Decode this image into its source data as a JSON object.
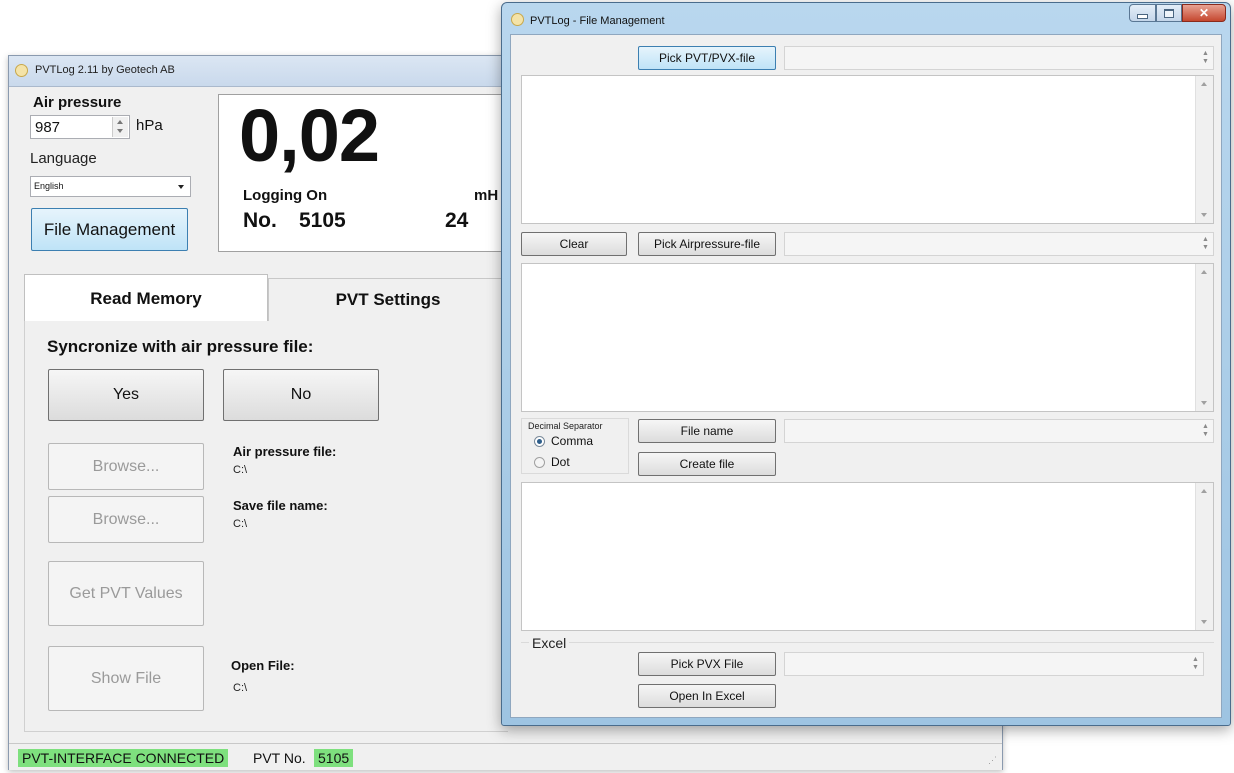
{
  "main_window": {
    "title": "PVTLog 2.11 by Geotech AB",
    "air_pressure_label": "Air pressure",
    "air_pressure_value": "987",
    "air_pressure_unit": "hPa",
    "language_label": "Language",
    "language_value": "English",
    "file_management_button": "File Management",
    "big_value": "0,02",
    "logging_status": "Logging On",
    "unit_partial": "mH",
    "number_label": "No.",
    "number_value": "5105",
    "second_value": "24",
    "tabs": [
      {
        "label": "Read Memory",
        "active": true
      },
      {
        "label": "PVT Settings",
        "active": false
      }
    ],
    "sync_heading": "Syncronize with air pressure file:",
    "yes_button": "Yes",
    "no_button": "No",
    "browse_button_1": "Browse...",
    "browse_button_2": "Browse...",
    "get_pvt_button": "Get PVT Values",
    "show_file_button": "Show File",
    "air_pressure_file_label": "Air pressure file:",
    "air_pressure_file_value": "C:\\",
    "save_file_label": "Save file name:",
    "save_file_value": "C:\\",
    "open_file_label": "Open File:",
    "open_file_value": "C:\\",
    "status_connected": "PVT-INTERFACE CONNECTED",
    "status_pvt_label": "PVT No.",
    "status_pvt_value": "5105"
  },
  "file_window": {
    "title": "PVTLog - File Management",
    "pick_pvt_button": "Pick PVT/PVX-file",
    "clear_button": "Clear",
    "pick_airpressure_button": "Pick Airpressure-file",
    "decimal_separator_label": "Decimal Separator",
    "radio_comma": "Comma",
    "radio_dot": "Dot",
    "decimal_selected": "Comma",
    "file_name_button": "File name",
    "create_file_button": "Create file",
    "excel_label": "Excel",
    "pick_pvx_button": "Pick PVX File",
    "open_excel_button": "Open In Excel"
  },
  "colors": {
    "status_green": "#7ee07e",
    "window_frame_blue": "#b9d7ee",
    "close_button_red": "#c5472f"
  }
}
